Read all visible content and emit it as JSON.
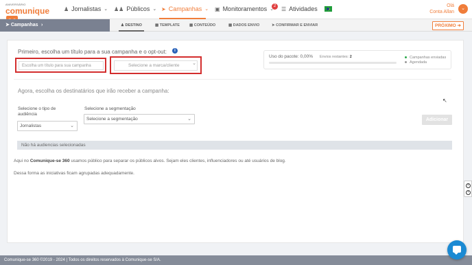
{
  "brand": {
    "small": "ANIVERSÁRIO",
    "name": "comunique",
    "suffix": "se"
  },
  "nav": {
    "items": [
      {
        "label": "Jornalistas",
        "icon": "user-icon"
      },
      {
        "label": "Públicos",
        "icon": "users-icon"
      },
      {
        "label": "Campanhas",
        "icon": "paper-plane-icon"
      },
      {
        "label": "Monitoramentos",
        "icon": "monitor-icon"
      },
      {
        "label": "Atividades",
        "icon": "list-icon"
      }
    ],
    "monitor_badge": "2",
    "user_greeting": "Olá",
    "user_name": "Conta Allan"
  },
  "steps": {
    "section": "Campanhas",
    "items": [
      "DESTINO",
      "TEMPLATE",
      "CONTEÚDO",
      "DADOS ENVIO",
      "CONFIRMAR E ENVIAR"
    ],
    "active": "DESTINO",
    "next_label": "PRÓXIMO"
  },
  "main": {
    "heading": "Primeiro, escolha um título para a sua campanha e o opt-out:",
    "title_placeholder": "Escolha um título para sua campanha",
    "brand_select": "Selecione a marca/cliente",
    "usage": {
      "label": "Uso do pacote:",
      "percent": "0,00%",
      "remaining_label": "Envios restantes:",
      "remaining_value": "2",
      "fill_fraction": 0.0
    },
    "legend": [
      "Campanhas enviadas",
      "Agendada"
    ],
    "legend_colors": [
      "#2ba84a",
      "#999999"
    ],
    "heading2": "Agora, escolha os destinatários que irão receber a campanha:",
    "audience_type_label": "Selecione o tipo de audiência",
    "audience_type_value": "Jornalistas",
    "segmentation_label": "Selecione a segmentação",
    "segmentation_value": "Selecione a segmentação",
    "add_label": "Adicionar",
    "no_audience": "Não há audiencias selecionadas",
    "para1_prefix": "Aqui no ",
    "para1_bold": "Comunique-se 360",
    "para1_suffix": " usamos público para separar os públicos alvos. Sejam eles clientes, influenciadores ou até usuários de blog.",
    "para2": "Dessa forma as iniciativas ficam agrupadas adequadamente."
  },
  "footer": "Comunique-se 360 ©2019 - 2024 | Todos os direitos reservados à Comunique-se S/A.",
  "colors": {
    "accent": "#f07d3a",
    "highlight": "#d32d2d",
    "info": "#2a62b9"
  }
}
